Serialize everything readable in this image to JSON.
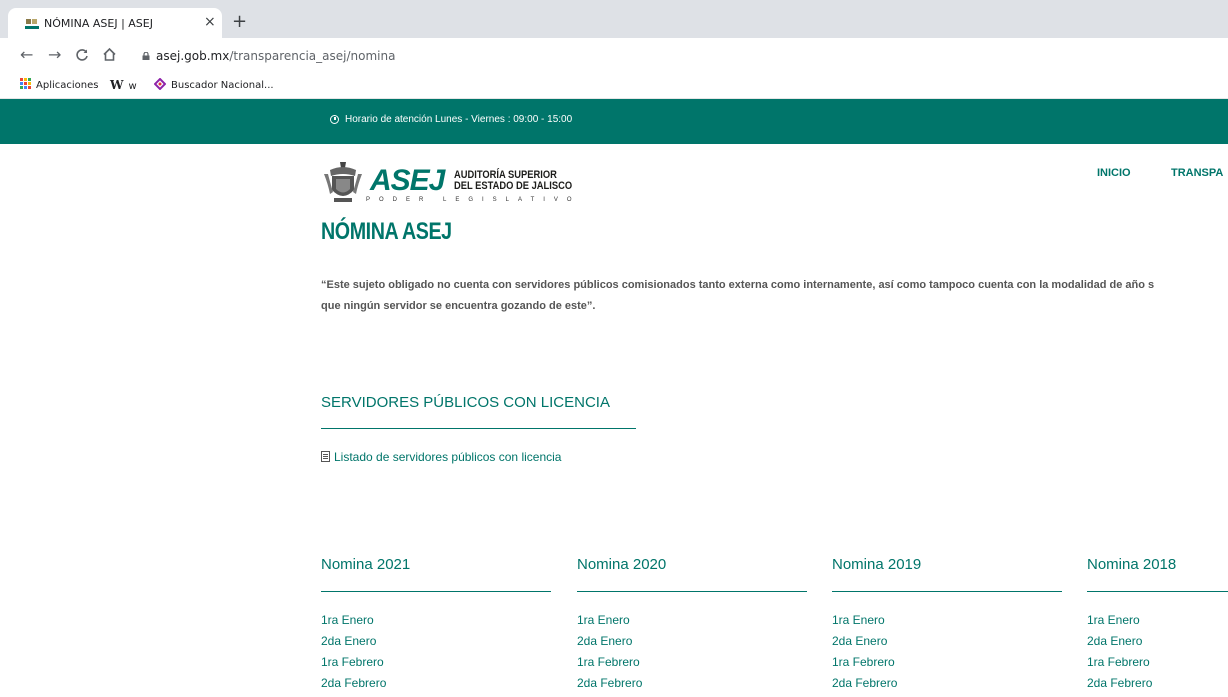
{
  "browser": {
    "tab_title": "NÓMINA ASEJ | ASEJ",
    "close_symbol": "×",
    "new_tab_symbol": "+",
    "url_domain": "asej.gob.mx",
    "url_path": "/transparencia_asej/nomina",
    "bookmarks": [
      {
        "label": "Aplicaciones",
        "icon": "apps-grid-icon"
      },
      {
        "label": "w",
        "icon": "wikipedia-icon",
        "icon_text": "W"
      },
      {
        "label": "Buscador Nacional...",
        "icon": "bookmark-logo-icon"
      }
    ]
  },
  "site": {
    "hours_text": "Horario de atención Lunes - Viernes : 09:00 - 15:00",
    "logo": {
      "brand": "ASEJ",
      "line1": "AUDITORÍA SUPERIOR",
      "line2": "DEL ESTADO DE JALISCO",
      "tagline": "PODER LEGISLATIVO"
    },
    "nav": [
      "INICIO",
      "TRANSPA"
    ],
    "page_title": "NÓMINA ASEJ",
    "notice_line1": "“Este sujeto obligado no cuenta con servidores públicos comisionados tanto externa como internamente, así como tampoco cuenta con la modalidad de año s",
    "notice_line2": "que ningún servidor se encuentra gozando de este”.",
    "license_section_title": "SERVIDORES PÚBLICOS CON LICENCIA",
    "license_link": "Listado de servidores públicos con licencia",
    "columns": [
      {
        "title": "Nomina 2021",
        "items": [
          "1ra Enero",
          "2da Enero",
          "1ra Febrero",
          "2da Febrero"
        ]
      },
      {
        "title": "Nomina 2020",
        "items": [
          "1ra Enero",
          "2da Enero",
          "1ra Febrero",
          "2da Febrero"
        ]
      },
      {
        "title": "Nomina 2019",
        "items": [
          "1ra Enero",
          "2da Enero",
          "1ra Febrero",
          "2da Febrero"
        ]
      },
      {
        "title": "Nomina 2018",
        "items": [
          "1ra Enero",
          "2da Enero",
          "1ra Febrero",
          "2da Febrero"
        ]
      }
    ]
  },
  "colors": {
    "brand_green": "#00756a",
    "chrome_tabstrip": "#dee1e6"
  }
}
